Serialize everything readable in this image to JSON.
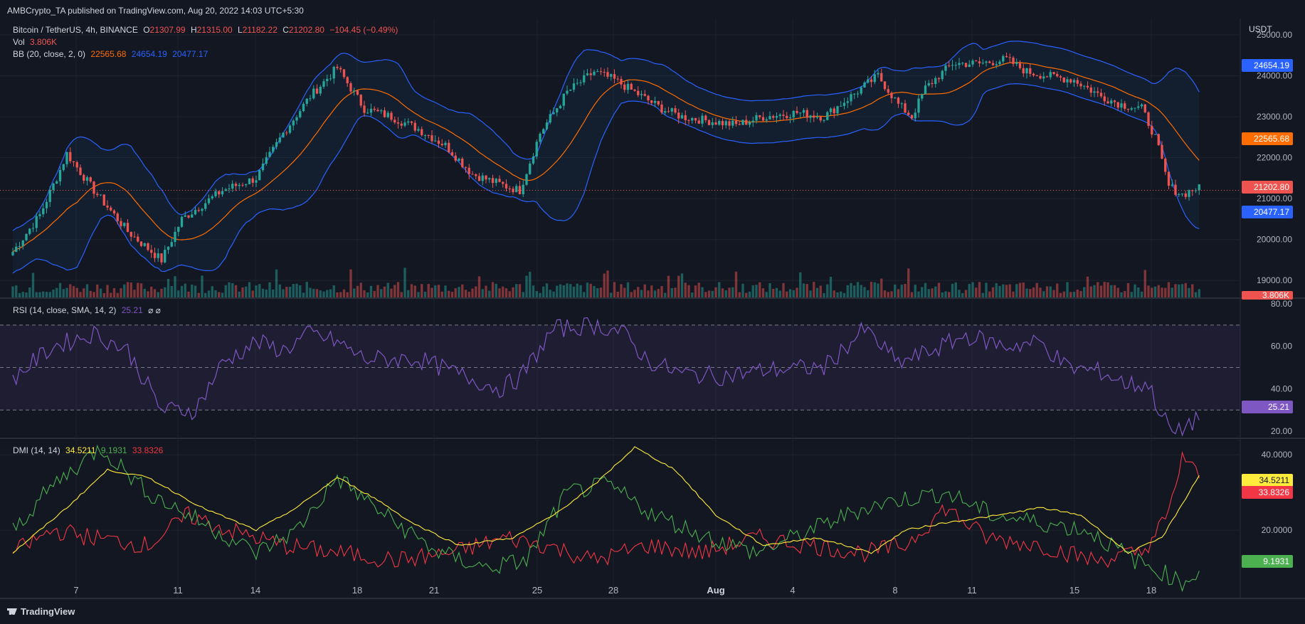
{
  "header": {
    "published": "AMBCrypto_TA published on TradingView.com, Aug 20, 2022 14:03 UTC+5:30"
  },
  "symbol": {
    "name": "Bitcoin / TetherUS, 4h, BINANCE",
    "o_label": "O",
    "o": "21307.99",
    "h_label": "H",
    "h": "21315.00",
    "l_label": "L",
    "l": "21182.22",
    "c_label": "C",
    "c": "21202.80",
    "change": "−104.45 (−0.49%)"
  },
  "vol": {
    "label": "Vol",
    "value": "3.806K"
  },
  "bb": {
    "label": "BB (20, close, 2, 0)",
    "basis": "22565.68",
    "upper": "24654.19",
    "lower": "20477.17"
  },
  "rsi": {
    "label": "RSI (14, close, SMA, 14, 2)",
    "value": "25.21",
    "extra": "⌀ ⌀"
  },
  "dmi": {
    "label": "DMI (14, 14)",
    "adx": "34.5211",
    "plus": "9.1931",
    "minus": "33.8326"
  },
  "axis": {
    "currency": "USDT",
    "price_ticks": [
      "25000.00",
      "24000.00",
      "23000.00",
      "22000.00",
      "21000.00",
      "20000.00",
      "19000.00"
    ],
    "rsi_ticks": [
      "80.00",
      "60.00",
      "40.00",
      "20.00"
    ],
    "dmi_ticks": [
      "40.0000",
      "20.0000"
    ],
    "date_ticks": [
      "7",
      "11",
      "14",
      "18",
      "21",
      "25",
      "28",
      "Aug",
      "4",
      "8",
      "11",
      "15",
      "18"
    ]
  },
  "price_labels": {
    "upper": "24654.19",
    "basis": "22565.68",
    "close": "21202.80",
    "lower": "20477.17",
    "vol": "3.806K",
    "rsi": "25.21",
    "adx": "34.5211",
    "minus": "33.8326",
    "plus": "9.1931"
  },
  "colors": {
    "bg": "#131722",
    "up": "#26a69a",
    "down": "#ef5350",
    "bb_band": "#2962ff",
    "bb_basis": "#ff6d00",
    "rsi": "#7e57c2",
    "adx": "#ffeb3b",
    "plus_di": "#4caf50",
    "minus_di": "#f23645",
    "grid": "#1e222d"
  },
  "branding": {
    "logo": "TradingView"
  },
  "chart_data": [
    {
      "type": "candlestick",
      "title": "Bitcoin / TetherUS, 4h, BINANCE",
      "ylim": [
        18900,
        25400
      ],
      "x_ticks": [
        "7",
        "11",
        "14",
        "18",
        "21",
        "25",
        "28",
        "Aug",
        "4",
        "8",
        "11",
        "15",
        "18"
      ],
      "close_path": [
        [
          0,
          19700
        ],
        [
          8,
          20600
        ],
        [
          14,
          21700
        ],
        [
          16,
          22100
        ],
        [
          24,
          21200
        ],
        [
          34,
          20200
        ],
        [
          44,
          19500
        ],
        [
          50,
          20500
        ],
        [
          62,
          21200
        ],
        [
          72,
          21500
        ],
        [
          80,
          22600
        ],
        [
          88,
          23500
        ],
        [
          96,
          24200
        ],
        [
          104,
          23200
        ],
        [
          112,
          23000
        ],
        [
          120,
          22700
        ],
        [
          128,
          22300
        ],
        [
          136,
          21600
        ],
        [
          146,
          21300
        ],
        [
          150,
          21200
        ],
        [
          156,
          22600
        ],
        [
          164,
          23600
        ],
        [
          172,
          24100
        ],
        [
          178,
          23900
        ],
        [
          186,
          23500
        ],
        [
          192,
          23200
        ],
        [
          198,
          23000
        ],
        [
          206,
          22900
        ],
        [
          214,
          22800
        ],
        [
          222,
          23000
        ],
        [
          232,
          23100
        ],
        [
          240,
          23000
        ],
        [
          248,
          23500
        ],
        [
          256,
          24000
        ],
        [
          262,
          23300
        ],
        [
          266,
          23000
        ],
        [
          270,
          23700
        ],
        [
          278,
          24300
        ],
        [
          286,
          24300
        ],
        [
          294,
          24400
        ],
        [
          300,
          24100
        ],
        [
          306,
          24000
        ],
        [
          314,
          23900
        ],
        [
          322,
          23500
        ],
        [
          328,
          23300
        ],
        [
          334,
          23200
        ],
        [
          338,
          22500
        ],
        [
          342,
          21300
        ],
        [
          346,
          21100
        ],
        [
          350,
          21250
        ]
      ],
      "bb": {
        "upper": 24654.19,
        "basis": 22565.68,
        "lower": 20477.17
      },
      "volume_last": "3.806K"
    },
    {
      "type": "line",
      "title": "RSI (14, close, SMA, 14, 2)",
      "ylim": [
        17,
        82
      ],
      "levels": [
        70,
        50,
        30
      ],
      "series": [
        {
          "name": "RSI",
          "values": [
            [
              0,
              45
            ],
            [
              12,
              60
            ],
            [
              24,
              66
            ],
            [
              34,
              58
            ],
            [
              44,
              30
            ],
            [
              54,
              30
            ],
            [
              62,
              52
            ],
            [
              72,
              62
            ],
            [
              80,
              58
            ],
            [
              88,
              66
            ],
            [
              96,
              62
            ],
            [
              104,
              54
            ],
            [
              112,
              54
            ],
            [
              120,
              54
            ],
            [
              130,
              48
            ],
            [
              144,
              40
            ],
            [
              150,
              45
            ],
            [
              160,
              68
            ],
            [
              172,
              70
            ],
            [
              180,
              67
            ],
            [
              188,
              53
            ],
            [
              198,
              47
            ],
            [
              210,
              46
            ],
            [
              224,
              49
            ],
            [
              240,
              50
            ],
            [
              252,
              68
            ],
            [
              262,
              52
            ],
            [
              272,
              58
            ],
            [
              282,
              65
            ],
            [
              294,
              60
            ],
            [
              304,
              62
            ],
            [
              312,
              50
            ],
            [
              322,
              48
            ],
            [
              330,
              42
            ],
            [
              336,
              42
            ],
            [
              340,
              27
            ],
            [
              344,
              18
            ],
            [
              348,
              24
            ],
            [
              351,
              25.21
            ]
          ]
        }
      ]
    },
    {
      "type": "line",
      "title": "DMI (14, 14)",
      "ylim": [
        4,
        44
      ],
      "series": [
        {
          "name": "",
          "values": [
            [
              0,
              14
            ],
            [
              16,
              26
            ],
            [
              28,
              36
            ],
            [
              40,
              34
            ],
            [
              56,
              26
            ],
            [
              72,
              20
            ],
            [
              84,
              26
            ],
            [
              96,
              34
            ],
            [
              108,
              28
            ],
            [
              118,
              22
            ],
            [
              132,
              16
            ],
            [
              148,
              18
            ],
            [
              160,
              24
            ],
            [
              172,
              32
            ],
            [
              184,
              42
            ],
            [
              196,
              36
            ],
            [
              208,
              24
            ],
            [
              222,
              16
            ],
            [
              238,
              18
            ],
            [
              254,
              14
            ],
            [
              264,
              20
            ],
            [
              276,
              22
            ],
            [
              292,
              24
            ],
            [
              304,
              26
            ],
            [
              316,
              24
            ],
            [
              330,
              14
            ],
            [
              340,
              18
            ],
            [
              348,
              30
            ],
            [
              351,
              34.5211
            ]
          ]
        },
        {
          "name": "",
          "values": [
            [
              0,
              20
            ],
            [
              12,
              32
            ],
            [
              26,
              42
            ],
            [
              40,
              30
            ],
            [
              56,
              22
            ],
            [
              72,
              14
            ],
            [
              84,
              20
            ],
            [
              96,
              34
            ],
            [
              110,
              24
            ],
            [
              126,
              14
            ],
            [
              140,
              10
            ],
            [
              152,
              12
            ],
            [
              164,
              30
            ],
            [
              176,
              32
            ],
            [
              190,
              24
            ],
            [
              206,
              18
            ],
            [
              220,
              14
            ],
            [
              236,
              20
            ],
            [
              252,
              26
            ],
            [
              262,
              28
            ],
            [
              276,
              30
            ],
            [
              290,
              24
            ],
            [
              304,
              22
            ],
            [
              318,
              20
            ],
            [
              332,
              12
            ],
            [
              342,
              8
            ],
            [
              346,
              6
            ],
            [
              351,
              9.1931
            ]
          ]
        },
        {
          "name": "",
          "values": [
            [
              0,
              14
            ],
            [
              12,
              20
            ],
            [
              24,
              18
            ],
            [
              40,
              16
            ],
            [
              52,
              24
            ],
            [
              64,
              20
            ],
            [
              80,
              16
            ],
            [
              96,
              14
            ],
            [
              114,
              12
            ],
            [
              130,
              14
            ],
            [
              146,
              18
            ],
            [
              158,
              16
            ],
            [
              172,
              12
            ],
            [
              188,
              16
            ],
            [
              204,
              14
            ],
            [
              220,
              18
            ],
            [
              236,
              16
            ],
            [
              252,
              14
            ],
            [
              264,
              16
            ],
            [
              276,
              26
            ],
            [
              288,
              18
            ],
            [
              304,
              16
            ],
            [
              320,
              12
            ],
            [
              334,
              14
            ],
            [
              342,
              24
            ],
            [
              346,
              40
            ],
            [
              351,
              33.8326
            ]
          ]
        }
      ]
    }
  ]
}
